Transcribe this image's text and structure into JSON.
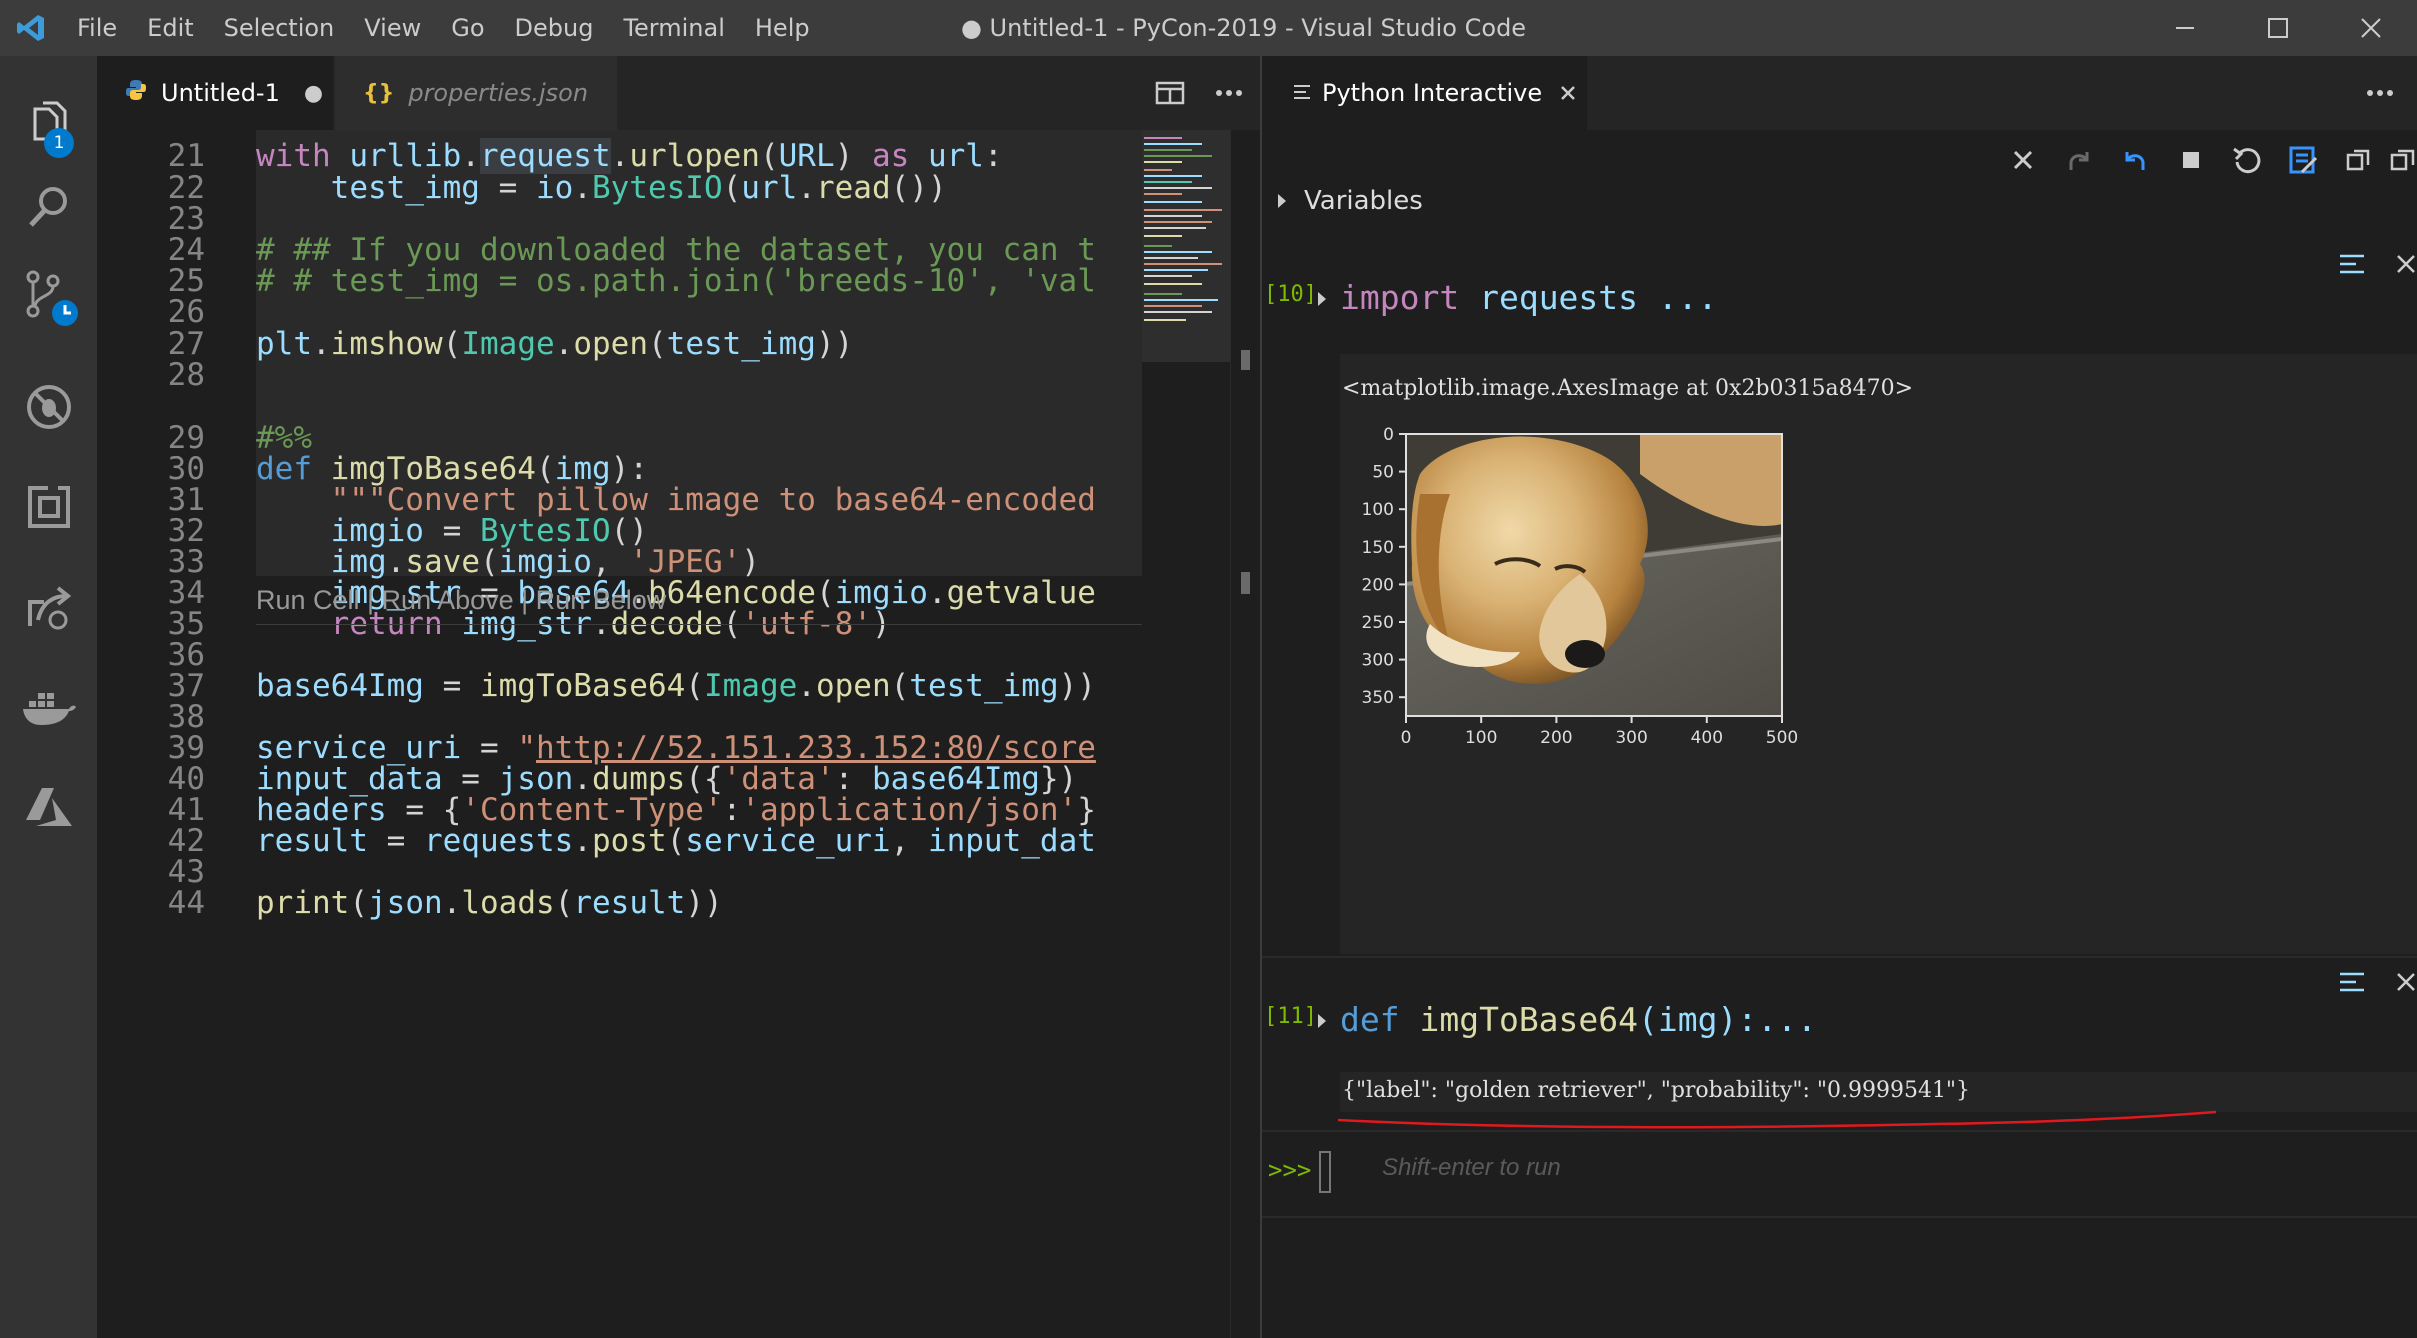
{
  "window": {
    "title": "● Untitled-1 - PyCon-2019 - Visual Studio Code",
    "menu": [
      "File",
      "Edit",
      "Selection",
      "View",
      "Go",
      "Debug",
      "Terminal",
      "Help"
    ]
  },
  "activity": {
    "explorer_badge": "1"
  },
  "editor": {
    "tabs": [
      {
        "label": "Untitled-1",
        "dirty": "●"
      },
      {
        "label": "properties.json",
        "icon": "{}"
      }
    ],
    "codelens": "Run Cell | Run Above | Run Below",
    "line_numbers": [
      "21",
      "22",
      "23",
      "24",
      "25",
      "26",
      "27",
      "28",
      "29",
      "30",
      "31",
      "32",
      "33",
      "34",
      "35",
      "36",
      "37",
      "38",
      "39",
      "40",
      "41",
      "42",
      "43",
      "44"
    ]
  },
  "interactive": {
    "tab_label": "Python Interactive",
    "variables_label": "Variables",
    "cells": [
      {
        "exec_count": "[10]",
        "code_kw": "import",
        "code_rest": " requests ...",
        "output_text": "<matplotlib.image.AxesImage at 0x2b0315a8470>"
      },
      {
        "exec_count": "[11]",
        "code_kw": "def",
        "code_fn": " imgToBase64",
        "code_args": "(img):...",
        "output_text": "{\"label\": \"golden retriever\", \"probability\": \"0.9999541\"}"
      }
    ],
    "prompt": ">>>",
    "input_placeholder": "Shift-enter to run"
  },
  "plot": {
    "x_ticks": [
      "0",
      "100",
      "200",
      "300",
      "400",
      "500"
    ],
    "y_ticks": [
      "0",
      "50",
      "100",
      "150",
      "200",
      "250",
      "300",
      "350"
    ]
  },
  "colors": {
    "accent": "#007acc",
    "titlebar": "#3c3c3c",
    "activity": "#333333",
    "background": "#1e1e1e"
  }
}
